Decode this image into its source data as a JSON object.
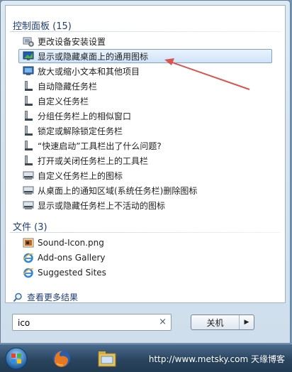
{
  "control_panel": {
    "header": "控制面板 (15)",
    "items": [
      {
        "label": "更改设备安装设置",
        "icon": "device-settings-icon"
      },
      {
        "label": "显示或隐藏桌面上的通用图标",
        "icon": "desktop-icon"
      },
      {
        "label": "放大或缩小文本和其他项目",
        "icon": "display-icon"
      },
      {
        "label": "自动隐藏任务栏",
        "icon": "taskbar-icon"
      },
      {
        "label": "自定义任务栏",
        "icon": "taskbar-icon"
      },
      {
        "label": "分组任务栏上的相似窗口",
        "icon": "taskbar-icon"
      },
      {
        "label": "锁定或解除锁定任务栏",
        "icon": "taskbar-icon"
      },
      {
        "label": "“快速启动”工具栏出了什么问题?",
        "icon": "taskbar-icon"
      },
      {
        "label": "打开或关闭任务栏上的工具栏",
        "icon": "taskbar-icon"
      },
      {
        "label": "自定义任务栏上的图标",
        "icon": "notification-icon"
      },
      {
        "label": "从桌面上的通知区域(系统任务栏)删除图标",
        "icon": "notification-icon"
      },
      {
        "label": "显示或隐藏任务栏上不活动的图标",
        "icon": "notification-icon"
      }
    ]
  },
  "files": {
    "header": "文件 (3)",
    "items": [
      {
        "label": "Sound-Icon.png",
        "icon": "image-file-icon"
      },
      {
        "label": "Add-ons Gallery",
        "icon": "internet-explorer-icon"
      },
      {
        "label": "Suggested Sites",
        "icon": "internet-explorer-icon"
      }
    ]
  },
  "see_more": "查看更多结果",
  "search": {
    "value": "ico",
    "clear": "×"
  },
  "shutdown": {
    "label": "关机",
    "arrow": "▶"
  },
  "taskbar": {
    "watermark": "http://www.metsky.com  天缘博客"
  },
  "colors": {
    "selection": "#cfe3f8",
    "header": "#1e3d78",
    "annotation_arrow": "#d9534f"
  }
}
